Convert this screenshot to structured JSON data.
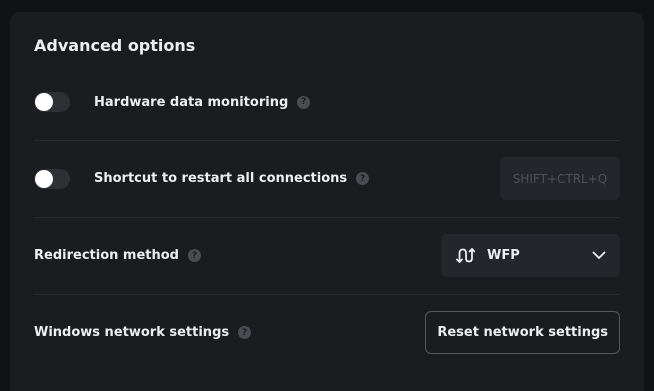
{
  "panel": {
    "title": "Advanced options"
  },
  "settings": [
    {
      "label": "Hardware data monitoring",
      "help_glyph": "?",
      "toggle_on": false
    },
    {
      "label": "Shortcut to restart all connections",
      "help_glyph": "?",
      "toggle_on": false,
      "shortcut": "SHIFT+CTRL+Q"
    },
    {
      "label": "Redirection method",
      "help_glyph": "?",
      "select_icon": "swap-arrows-icon",
      "select_value": "WFP",
      "select_chevron": "chevron-down-icon"
    },
    {
      "label": "Windows network settings",
      "help_glyph": "?",
      "button_label": "Reset network settings"
    }
  ],
  "colors": {
    "background": "#111215",
    "panel": "#1b1c20",
    "control": "#25262b",
    "toggle_off": "#2f3035",
    "text": "#eceef2",
    "muted": "#4f5157"
  }
}
